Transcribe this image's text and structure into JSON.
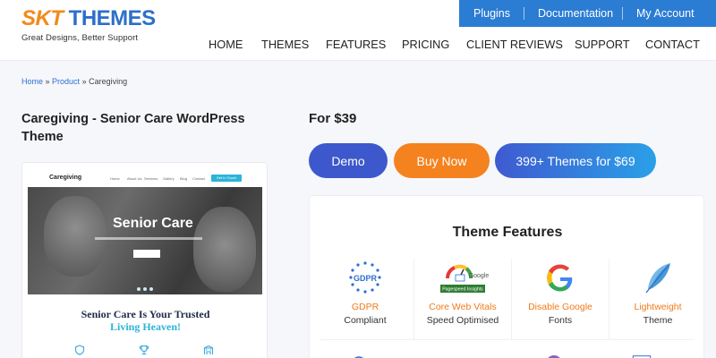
{
  "logo": {
    "brand_part1": "SKT",
    "brand_part2": " THEMES",
    "tagline": "Great Designs, Better Support"
  },
  "topbar": {
    "links": [
      "Plugins",
      "Documentation",
      "My Account"
    ]
  },
  "nav": {
    "items": [
      "HOME",
      "THEMES",
      "FEATURES",
      "PRICING",
      "CLIENT REVIEWS",
      "SUPPORT",
      "CONTACT"
    ]
  },
  "breadcrumb": {
    "home": "Home",
    "sep": " » ",
    "product": "Product",
    "current": "Caregiving"
  },
  "product": {
    "title": "Caregiving - Senior Care WordPress Theme",
    "price": "For $39"
  },
  "preview": {
    "brand": "Caregiving",
    "menu": [
      "Home",
      "About Us",
      "Services",
      "Gallery",
      "Blog",
      "Contact"
    ],
    "cta": "Get In Touch",
    "hero_title": "Senior Care",
    "heading_line1": "Senior Care Is Your Trusted",
    "heading_line2": "Living Heaven!"
  },
  "buttons": {
    "demo": "Demo",
    "buy": "Buy Now",
    "bundle": "399+ Themes for $69"
  },
  "features": {
    "title": "Theme Features",
    "items": [
      {
        "line1": "GDPR",
        "line2": "Compliant",
        "icon": "gdpr-icon"
      },
      {
        "line1": "Core Web Vitals",
        "line2": "Speed Optimised",
        "icon": "pagespeed-gauge-icon"
      },
      {
        "line1": "Disable Google",
        "line2": "Fonts",
        "icon": "google-icon"
      },
      {
        "line1": "Lightweight",
        "line2": "Theme",
        "icon": "feather-icon"
      }
    ],
    "icon_labels": {
      "gdpr": "GDPR",
      "google_text": "Google",
      "pagespeed": "Pagespeed Insights"
    }
  },
  "colors": {
    "accent_blue": "#2b7cd3",
    "accent_orange": "#f4821f",
    "demo_blue": "#3d58cc",
    "feature_orange": "#f07a1a"
  }
}
